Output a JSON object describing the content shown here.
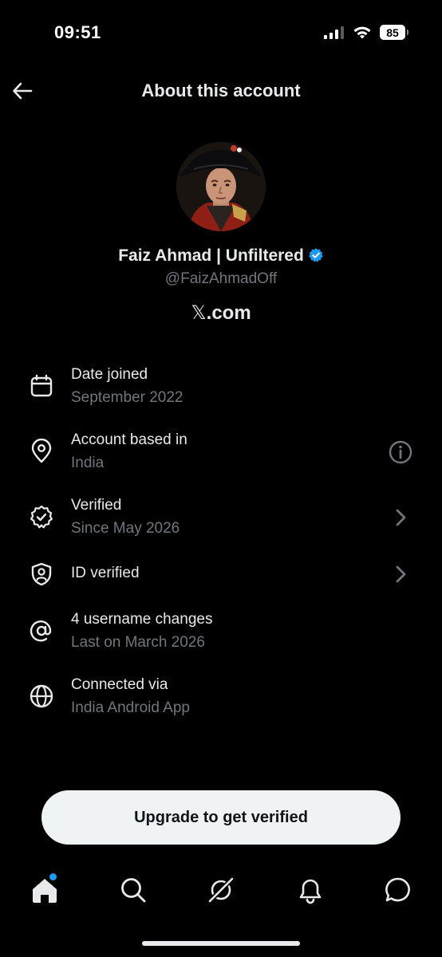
{
  "status_bar": {
    "time": "09:51",
    "battery": "85"
  },
  "header": {
    "title": "About this account"
  },
  "profile": {
    "display_name": "Faiz Ahmad | Unfiltered",
    "handle": "@FaizAhmadOff",
    "site_glyph": "𝕏",
    "site_suffix": ".com"
  },
  "rows": [
    {
      "icon": "calendar-icon",
      "title": "Date joined",
      "subtitle": "September 2022"
    },
    {
      "icon": "location-pin-icon",
      "title": "Account based in",
      "subtitle": "India",
      "right_icon": "info-icon"
    },
    {
      "icon": "verified-badge-icon",
      "title": "Verified",
      "subtitle": "Since May 2026",
      "right_icon": "chevron-right-icon"
    },
    {
      "icon": "id-shield-icon",
      "title": "ID verified",
      "right_icon": "chevron-right-icon"
    },
    {
      "icon": "at-sign-icon",
      "title": "4 username changes",
      "subtitle": "Last on March 2026"
    },
    {
      "icon": "globe-icon",
      "title": "Connected via",
      "subtitle": "India Android App"
    }
  ],
  "cta": {
    "label": "Upgrade to get verified"
  },
  "bottom_nav": [
    "home-icon",
    "search-icon",
    "grok-icon",
    "notifications-icon",
    "messages-icon"
  ],
  "colors": {
    "background": "#000000",
    "primary_text": "#e7e9ea",
    "secondary_text": "#71767b",
    "accent": "#1d9bf0",
    "button_bg": "#eff3f4"
  }
}
